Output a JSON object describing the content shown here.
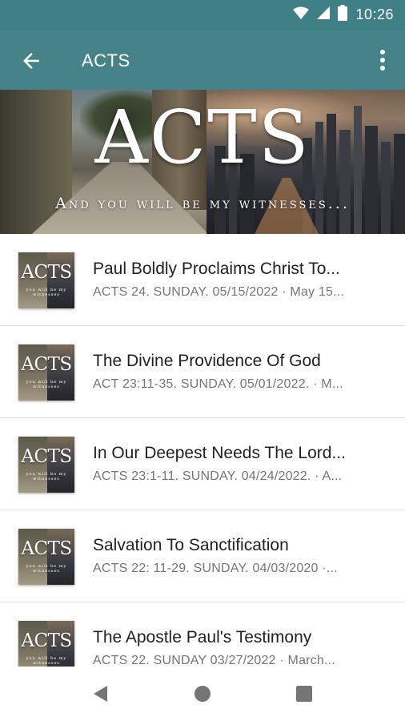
{
  "status_bar": {
    "time": "10:26",
    "icons": [
      "wifi-icon",
      "signal-icon",
      "battery-icon"
    ]
  },
  "app_bar": {
    "title": "ACTS",
    "back_icon": "arrow-back-icon",
    "menu_icon": "more-vert-icon"
  },
  "banner": {
    "title": "ACTS",
    "subtitle": "And you will be my witnesses..."
  },
  "thumbnail": {
    "title": "ACTS",
    "subtitle": "you will be my witnesses"
  },
  "sermons": [
    {
      "title": "Paul Boldly Proclaims Christ To...",
      "subtitle": "ACTS 24. SUNDAY. 05/15/2022 · May 15..."
    },
    {
      "title": "The Divine Providence Of God",
      "subtitle": "ACT 23:11-35. SUNDAY. 05/01/2022. · M..."
    },
    {
      "title": "In Our Deepest Needs The Lord...",
      "subtitle": "ACTS 23:1-11. SUNDAY. 04/24/2022. · A..."
    },
    {
      "title": "Salvation To Sanctification",
      "subtitle": "ACTS 22: 11-29. SUNDAY. 04/03/2020 ·..."
    },
    {
      "title": "The Apostle Paul's Testimony",
      "subtitle": "ACTS 22. SUNDAY 03/27/2022 · March..."
    }
  ],
  "nav_bar": {
    "icons": [
      "back-triangle-icon",
      "home-circle-icon",
      "recents-square-icon"
    ]
  },
  "colors": {
    "app_bar": "#458389",
    "status_bar": "#3f7f86",
    "title_text": "#212121",
    "subtitle_text": "#757575"
  }
}
